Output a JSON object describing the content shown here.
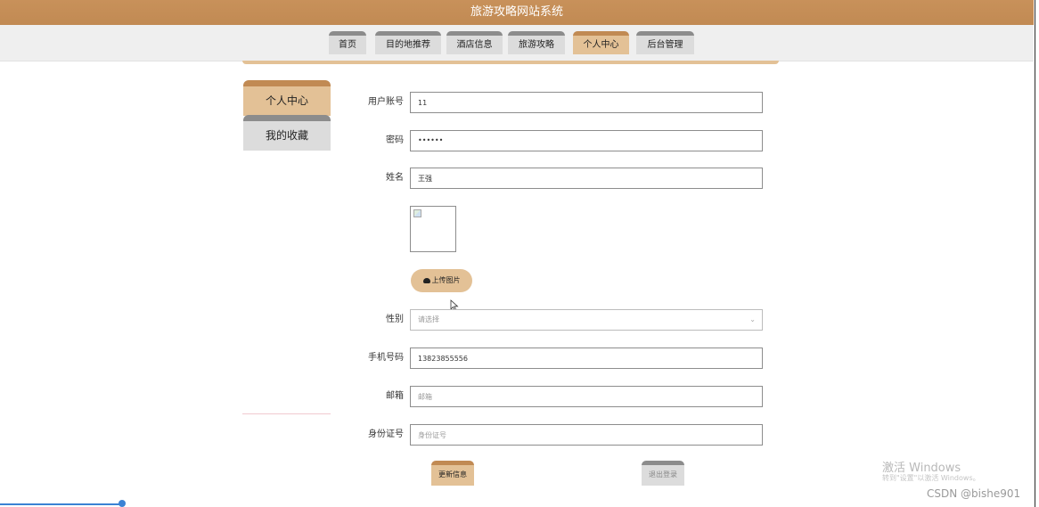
{
  "header": {
    "title": "旅游攻略网站系统"
  },
  "nav": {
    "tabs": [
      {
        "label": "首页"
      },
      {
        "label": "目的地推荐"
      },
      {
        "label": "酒店信息"
      },
      {
        "label": "旅游攻略"
      },
      {
        "label": "个人中心"
      },
      {
        "label": "后台管理"
      }
    ],
    "active_tab": "个人中心"
  },
  "sidebar": {
    "items": [
      {
        "label": "个人中心",
        "active": true
      },
      {
        "label": "我的收藏",
        "active": false
      }
    ]
  },
  "form": {
    "account": {
      "label": "用户账号",
      "value": "11"
    },
    "password": {
      "label": "密码",
      "value": "••••••"
    },
    "name": {
      "label": "姓名",
      "value": "王强"
    },
    "upload_label": "上传图片",
    "gender": {
      "label": "性别",
      "placeholder": "请选择"
    },
    "phone": {
      "label": "手机号码",
      "value": "13823855556"
    },
    "email": {
      "label": "邮箱",
      "placeholder": "邮箱"
    },
    "id_card": {
      "label": "身份证号",
      "placeholder": "身份证号"
    }
  },
  "actions": {
    "update_label": "更新信息",
    "logout_label": "退出登录"
  },
  "overlay": {
    "windows_line1": "激活 Windows",
    "windows_line2": "转到\"设置\"以激活 Windows。",
    "credit": "CSDN @bishe901"
  },
  "colors": {
    "accent": "#c18a53",
    "accent_light": "#e3c196",
    "inactive_tab": "#dcdcdc"
  }
}
